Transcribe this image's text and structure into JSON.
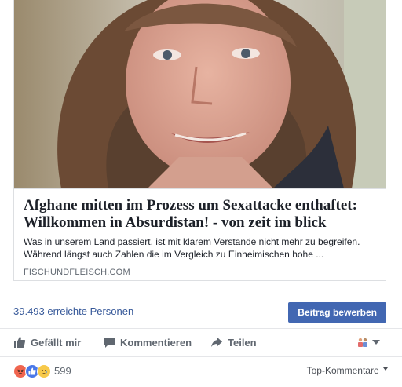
{
  "link": {
    "title": "Afghane mitten im Prozess um Sexattacke enthaftet: Willkommen in Absurdistan! - von zeit im blick",
    "description": "Was in unserem Land passiert, ist mit klarem Verstande nicht mehr zu begreifen. Während längst auch Zahlen die im Vergleich zu Einheimischen hohe ...",
    "domain": "FISCHUNDFLEISCH.COM"
  },
  "stats": {
    "reach": "39.493 erreichte Personen",
    "boost_label": "Beitrag bewerben"
  },
  "actions": {
    "like": "Gefällt mir",
    "comment": "Kommentieren",
    "share": "Teilen"
  },
  "reactions": {
    "icons": [
      "angry-reaction-icon",
      "like-reaction-icon",
      "sad-reaction-icon"
    ],
    "count": "599",
    "sort_label": "Top-Kommentare"
  },
  "colors": {
    "link_blue": "#365899",
    "button_blue": "#4267b2",
    "muted": "#606770"
  }
}
